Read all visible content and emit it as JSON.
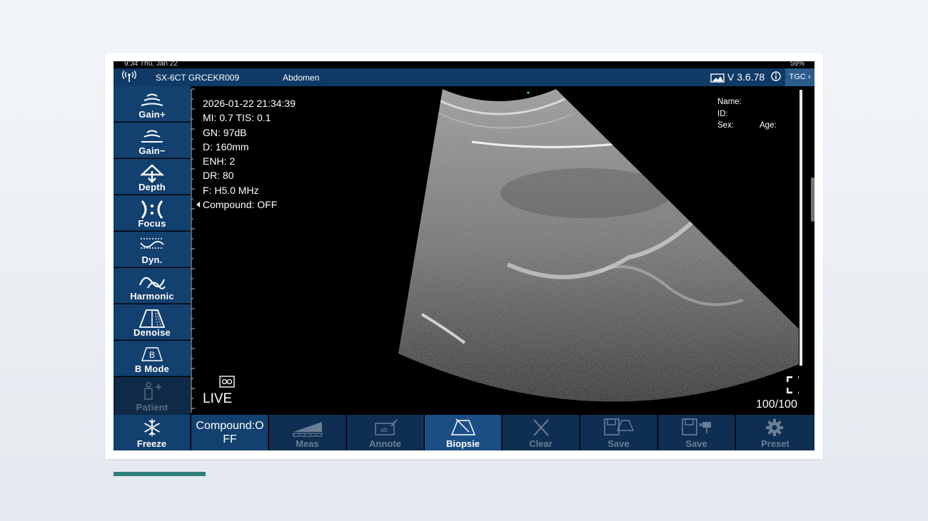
{
  "status_bar": {
    "time_date": "9:34  Thu, Jan 22",
    "battery": "59%"
  },
  "header": {
    "device": "SX-6CT GRCEKR009",
    "exam_preset": "Abdomen",
    "version": "V 3.6.78",
    "tgc_label": "TGC"
  },
  "left_panel": [
    {
      "label": "Gain+"
    },
    {
      "label": "Gain−"
    },
    {
      "label": "Depth"
    },
    {
      "label": "Focus"
    },
    {
      "label": "Dyn."
    },
    {
      "label": "Harmonic"
    },
    {
      "label": "Denoise"
    },
    {
      "label": "B Mode"
    },
    {
      "label": "Patient"
    }
  ],
  "image_params": {
    "datetime": "2026-01-22 21:34:39",
    "mi_tis": "MI:  0.7  TIS:  0.1",
    "gain": "GN: 97dB",
    "depth": "D: 160mm",
    "enhance": "ENH: 2",
    "dynamic_range": "DR: 80",
    "frequency": "F: H5.0 MHz",
    "compound": "Compound:  OFF"
  },
  "patient_info": {
    "name_label": "Name:",
    "id_label": "ID:",
    "sex_label": "Sex:",
    "age_label": "Age:"
  },
  "live_label": "LIVE",
  "frame_counter": "100/100",
  "bottom_toolbar": [
    {
      "label": "Freeze"
    },
    {
      "label": "Compound:OFF"
    },
    {
      "label": "Meas"
    },
    {
      "label": "Annote"
    },
    {
      "label": "Biopsie"
    },
    {
      "label": "Clear"
    },
    {
      "label": "Save"
    },
    {
      "label": "Save"
    },
    {
      "label": "Preset"
    }
  ],
  "colors": {
    "panel_blue": "#12406f",
    "header_blue": "#0f3a66",
    "active_blue": "#1b4e85",
    "accent_teal": "#2e7f7a"
  }
}
